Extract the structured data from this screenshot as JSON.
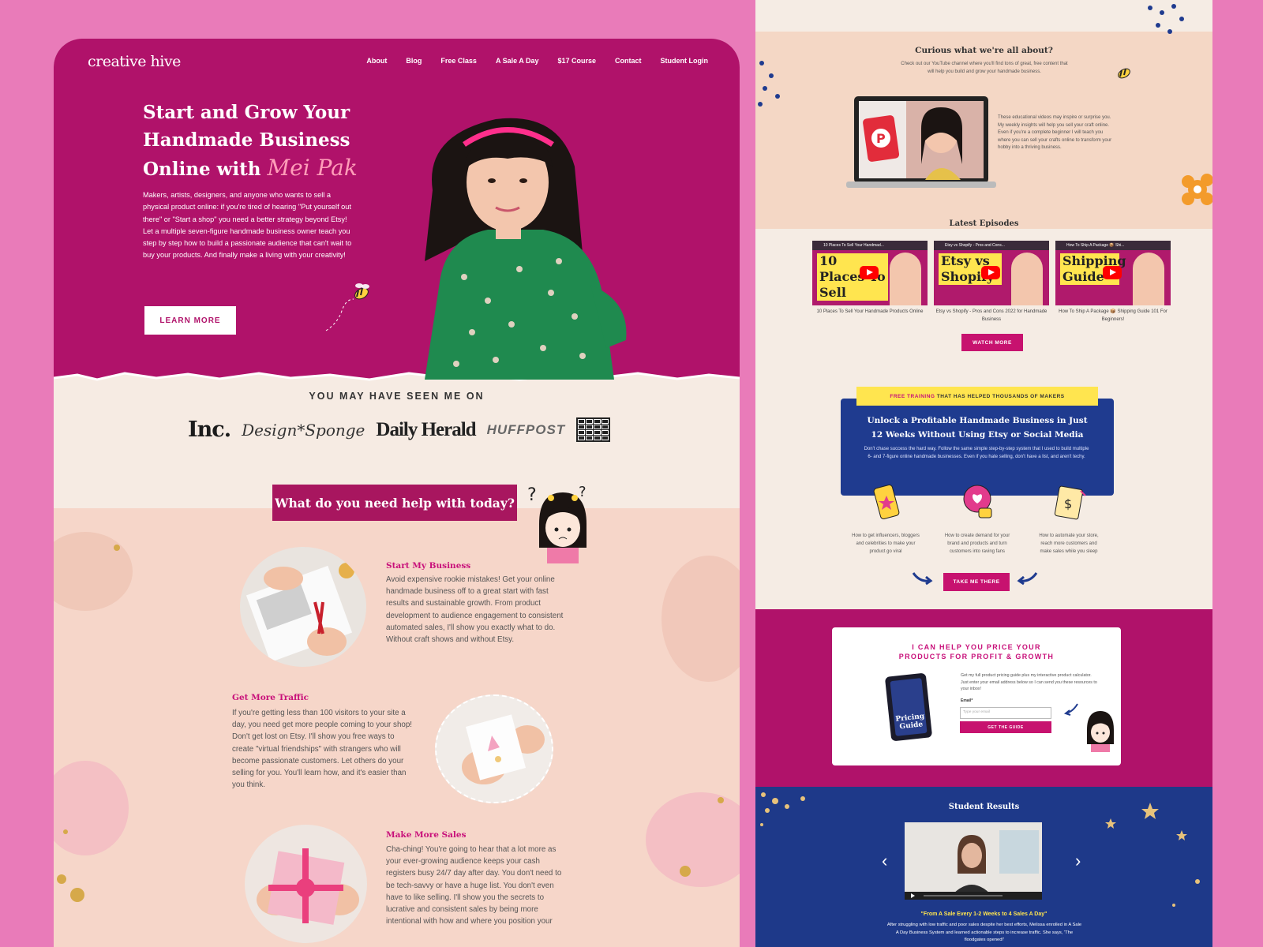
{
  "left": {
    "logo": "creative hive",
    "nav": [
      "About",
      "Blog",
      "Free Class",
      "A Sale A Day",
      "$17 Course",
      "Contact",
      "Student Login"
    ],
    "hero": {
      "title_line1": "Start and Grow Your",
      "title_line2": "Handmade Business",
      "title_line3": "Online with",
      "script_name": "Mei Pak",
      "text": "Makers, artists, designers, and anyone who wants to sell a physical product online: if you're tired of hearing \"Put yourself out there\" or \"Start a shop\" you need a better strategy beyond Etsy! Let a multiple seven-figure handmade business owner teach you step by step how to build a passionate audience that can't wait to buy your products. And finally make a living with your creativity!",
      "button": "LEARN MORE"
    },
    "seen": {
      "heading": "YOU MAY HAVE SEEN ME ON",
      "logos": [
        "Inc.",
        "Design*Sponge",
        "Daily Herald",
        "HUFFPOST"
      ]
    },
    "help": {
      "banner": "What do you need help with today?",
      "sections": [
        {
          "title": "Start My Business",
          "text": "Avoid expensive rookie mistakes! Get your online handmade business off to a great start with fast results and sustainable growth. From product development to audience engagement to consistent automated sales, I'll show you exactly what to do. Without craft shows and without Etsy."
        },
        {
          "title": "Get More Traffic",
          "text": "If you're getting less than 100 visitors to your site a day, you need get more people coming to your shop! Don't get lost on Etsy. I'll show you free ways to create \"virtual friendships\" with strangers who will become passionate customers. Let others do your selling for you. You'll learn how, and it's easier than you think."
        },
        {
          "title": "Make More Sales",
          "text": "Cha-ching! You're going to hear that a lot more as your ever-growing audience keeps your cash registers busy 24/7 day after day. You don't need to be tech-savvy or have a huge list. You don't even have to like selling. I'll show you the secrets to lucrative and consistent sales by being more intentional with how and where you position your"
        }
      ]
    }
  },
  "right": {
    "curious": {
      "title": "Curious what we're all about?",
      "text": "Check out our YouTube channel where you'll find tons of great, free content that will help you build and grow your handmade business.",
      "side_text": "These educational videos may inspire or surprise you. My weekly insights will help you sell your craft online. Even if you're a complete beginner I will teach you where you can sell your crafts online to transform your hobby into a thriving business."
    },
    "episodes": {
      "title": "Latest Episodes",
      "items": [
        {
          "thumb": "10 Places To Sell",
          "caption": "10 Places To Sell Your Handmade Products Online",
          "header": "10 Places To Sell Your Handmad..."
        },
        {
          "thumb": "Etsy vs Shopify",
          "caption": "Etsy vs Shopify - Pros and Cons 2022 for Handmade Business",
          "header": "Etsy vs Shopify - Pros and Cons..."
        },
        {
          "thumb": "Shipping Guide",
          "caption": "How To Ship A Package 📦 Shipping Guide 101 For Beginners!",
          "header": "How To Ship A Package 📦 Shi..."
        }
      ],
      "button": "WATCH MORE"
    },
    "training": {
      "tag_prefix": "FREE TRAINING",
      "tag_suffix": "THAT HAS HELPED THOUSANDS OF MAKERS",
      "title": "Unlock a Profitable Handmade Business in Just 12 Weeks Without Using Etsy or Social Media",
      "text": "Don't chase success the hard way. Follow the same simple step-by-step system that I used to build multiple 6- and 7-figure online handmade businesses. Even if you hate selling, don't have a list, and aren't techy.",
      "features": [
        "How to get influencers, bloggers and celebrities to make your product go viral",
        "How to create demand for your brand and products and turn customers into raving fans",
        "How to automate your store, reach more customers and make sales while you sleep"
      ],
      "button": "TAKE ME THERE"
    },
    "pricing": {
      "title_line1": "I CAN HELP YOU PRICE YOUR",
      "title_line2": "PRODUCTS FOR PROFIT & GROWTH",
      "text": "Get my full product pricing guide plus my interactive product calculator. Just enter your email address below so I can send you these resources to your inbox!",
      "email_label": "Email*",
      "email_placeholder": "Type your email",
      "button": "GET THE GUIDE",
      "book_title": "Pricing Guide"
    },
    "results": {
      "title": "Student Results",
      "quote": "\"From A Sale Every 1-2 Weeks to 4 Sales A Day\"",
      "text": "After struggling with low traffic and poor sales despite her best efforts, Melissa enrolled in A Sale A Day Business System and learned actionable steps to increase traffic. She says, 'The floodgates opened!'"
    }
  },
  "colors": {
    "magenta": "#b0126a",
    "pink_button": "#c7126f",
    "navy": "#1e3989",
    "yellow": "#ffe54f",
    "background": "#e97bb9"
  }
}
